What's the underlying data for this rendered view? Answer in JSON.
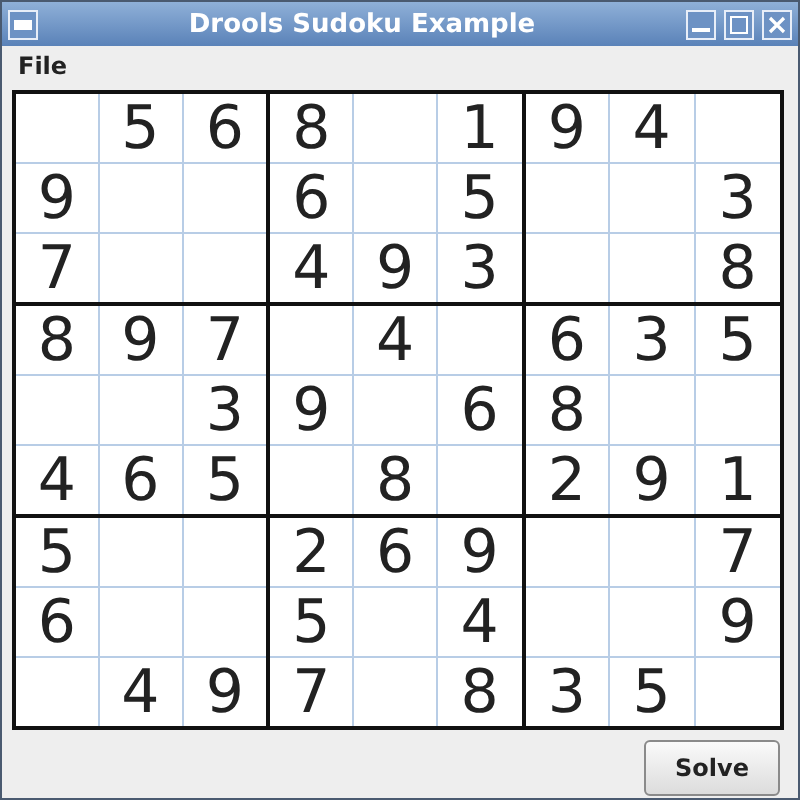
{
  "window": {
    "title": "Drools Sudoku Example"
  },
  "menu": [
    "File"
  ],
  "rows": [
    [
      null,
      "5",
      "6",
      "8",
      null,
      "1",
      "9",
      "4",
      null
    ],
    [
      "9",
      null,
      null,
      "6",
      null,
      "5",
      null,
      null,
      "3"
    ],
    [
      "7",
      null,
      null,
      "4",
      "9",
      "3",
      null,
      null,
      "8"
    ],
    [
      "8",
      "9",
      "7",
      null,
      "4",
      null,
      "6",
      "3",
      "5"
    ],
    [
      null,
      null,
      "3",
      "9",
      null,
      "6",
      "8",
      null,
      null
    ],
    [
      "4",
      "6",
      "5",
      null,
      "8",
      null,
      "2",
      "9",
      "1"
    ],
    [
      "5",
      null,
      null,
      "2",
      "6",
      "9",
      null,
      null,
      "7"
    ],
    [
      "6",
      null,
      null,
      "5",
      null,
      "4",
      null,
      null,
      "9"
    ],
    [
      null,
      "4",
      "9",
      "7",
      null,
      "8",
      "3",
      "5",
      null
    ]
  ],
  "buttons": [
    "Solve"
  ]
}
